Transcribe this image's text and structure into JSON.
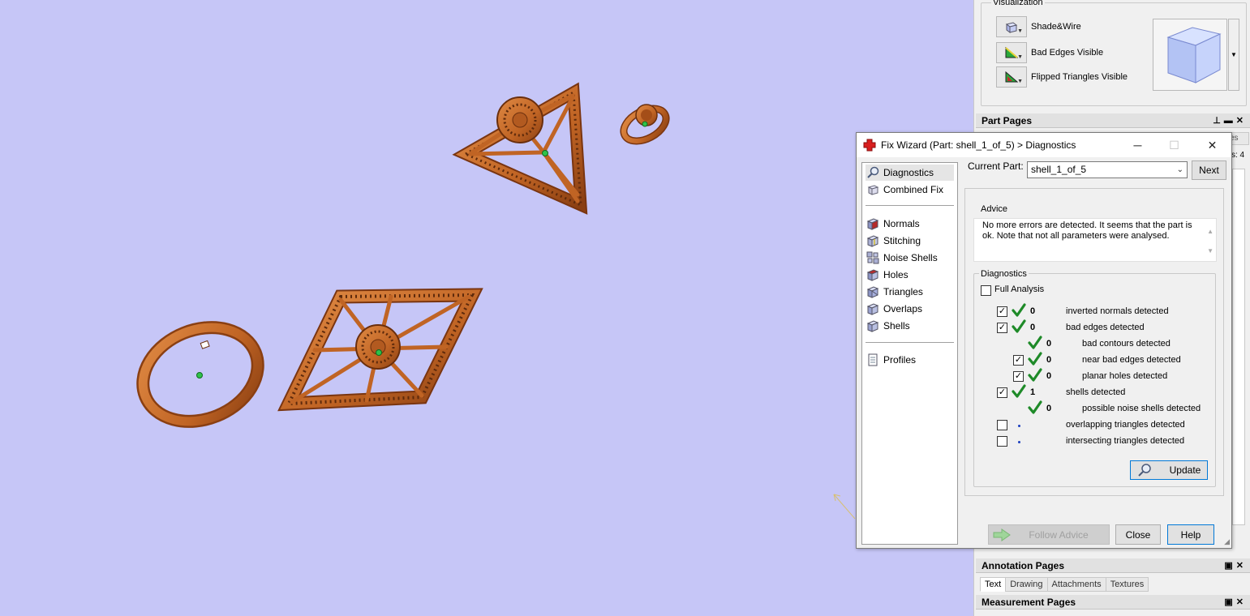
{
  "right_panel": {
    "visualization": {
      "label": "Visualization",
      "items": [
        "Shade&Wire",
        "Bad Edges Visible",
        "Flipped Triangles Visible"
      ]
    },
    "part_pages": {
      "title": "Part Pages",
      "obscured_tab_fragment": "es",
      "obscured_count": "s: 4"
    },
    "annotation_pages": {
      "title": "Annotation Pages",
      "tabs": [
        "Text",
        "Drawing",
        "Attachments",
        "Textures"
      ]
    },
    "measurement_pages": {
      "title": "Measurement Pages"
    }
  },
  "dialog": {
    "title": "Fix Wizard (Part: shell_1_of_5) > Diagnostics",
    "nav": {
      "top": [
        "Diagnostics",
        "Combined Fix"
      ],
      "fixes": [
        "Normals",
        "Stitching",
        "Noise Shells",
        "Holes",
        "Triangles",
        "Overlaps",
        "Shells"
      ],
      "bottom": [
        "Profiles"
      ]
    },
    "current_part_label": "Current Part:",
    "current_part_value": "shell_1_of_5",
    "next_label": "Next",
    "advice_label": "Advice",
    "advice_text": "No more errors are detected. It seems that the part is ok. Note that not all parameters were analysed.",
    "diagnostics_label": "Diagnostics",
    "full_analysis_label": "Full Analysis",
    "rows": [
      {
        "count": "0",
        "label": "inverted normals detected",
        "checked": true,
        "status": "ok"
      },
      {
        "count": "0",
        "label": "bad edges detected",
        "checked": true,
        "status": "ok"
      },
      {
        "count": "0",
        "label": "bad contours detected",
        "checked": null,
        "status": "ok"
      },
      {
        "count": "0",
        "label": "near bad edges detected",
        "checked": true,
        "status": "ok"
      },
      {
        "count": "0",
        "label": "planar holes detected",
        "checked": true,
        "status": "ok"
      },
      {
        "count": "1",
        "label": "shells detected",
        "checked": true,
        "status": "ok"
      },
      {
        "count": "0",
        "label": "possible noise shells detected",
        "checked": null,
        "status": "ok"
      },
      {
        "count": "",
        "label": "overlapping triangles detected",
        "checked": false,
        "status": "pending"
      },
      {
        "count": "",
        "label": "intersecting triangles detected",
        "checked": false,
        "status": "pending"
      }
    ],
    "update_label": "Update",
    "follow_advice_label": "Follow Advice",
    "close_label": "Close",
    "help_label": "Help"
  },
  "colors": {
    "viewport_bg": "#c6c6f7",
    "part_copper": "#c8692a",
    "tick_green": "#1e8a28",
    "accent_blue": "#0078d7"
  }
}
